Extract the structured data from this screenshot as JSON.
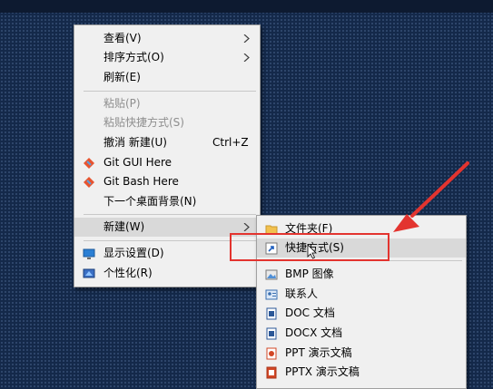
{
  "context_menu": {
    "items": [
      {
        "label": "查看(V)",
        "submenu": true
      },
      {
        "label": "排序方式(O)",
        "submenu": true
      },
      {
        "label": "刷新(E)"
      },
      {
        "label": "粘贴(P)",
        "disabled": true
      },
      {
        "label": "粘贴快捷方式(S)",
        "disabled": true
      },
      {
        "label": "撤消 新建(U)",
        "accelerator": "Ctrl+Z"
      },
      {
        "label": "Git GUI Here",
        "icon": "git-icon"
      },
      {
        "label": "Git Bash Here",
        "icon": "git-icon"
      },
      {
        "label": "下一个桌面背景(N)"
      },
      {
        "label": "新建(W)",
        "submenu": true,
        "highlighted": true
      },
      {
        "label": "显示设置(D)",
        "icon": "display-settings-icon"
      },
      {
        "label": "个性化(R)",
        "icon": "personalize-icon"
      }
    ]
  },
  "new_submenu": {
    "items": [
      {
        "label": "文件夹(F)",
        "icon": "folder-icon"
      },
      {
        "label": "快捷方式(S)",
        "icon": "shortcut-icon",
        "highlighted": true
      },
      {
        "label": "BMP 图像",
        "icon": "bmp-icon"
      },
      {
        "label": "联系人",
        "icon": "contact-icon"
      },
      {
        "label": "DOC 文档",
        "icon": "doc-icon"
      },
      {
        "label": "DOCX 文档",
        "icon": "docx-icon"
      },
      {
        "label": "PPT 演示文稿",
        "icon": "ppt-icon"
      },
      {
        "label": "PPTX 演示文稿",
        "icon": "pptx-icon"
      }
    ]
  },
  "colors": {
    "desktop": "#14294a",
    "menu_bg": "#f0f0f0",
    "highlight": "#d9d9d9",
    "annotation_red": "#e3342f"
  }
}
